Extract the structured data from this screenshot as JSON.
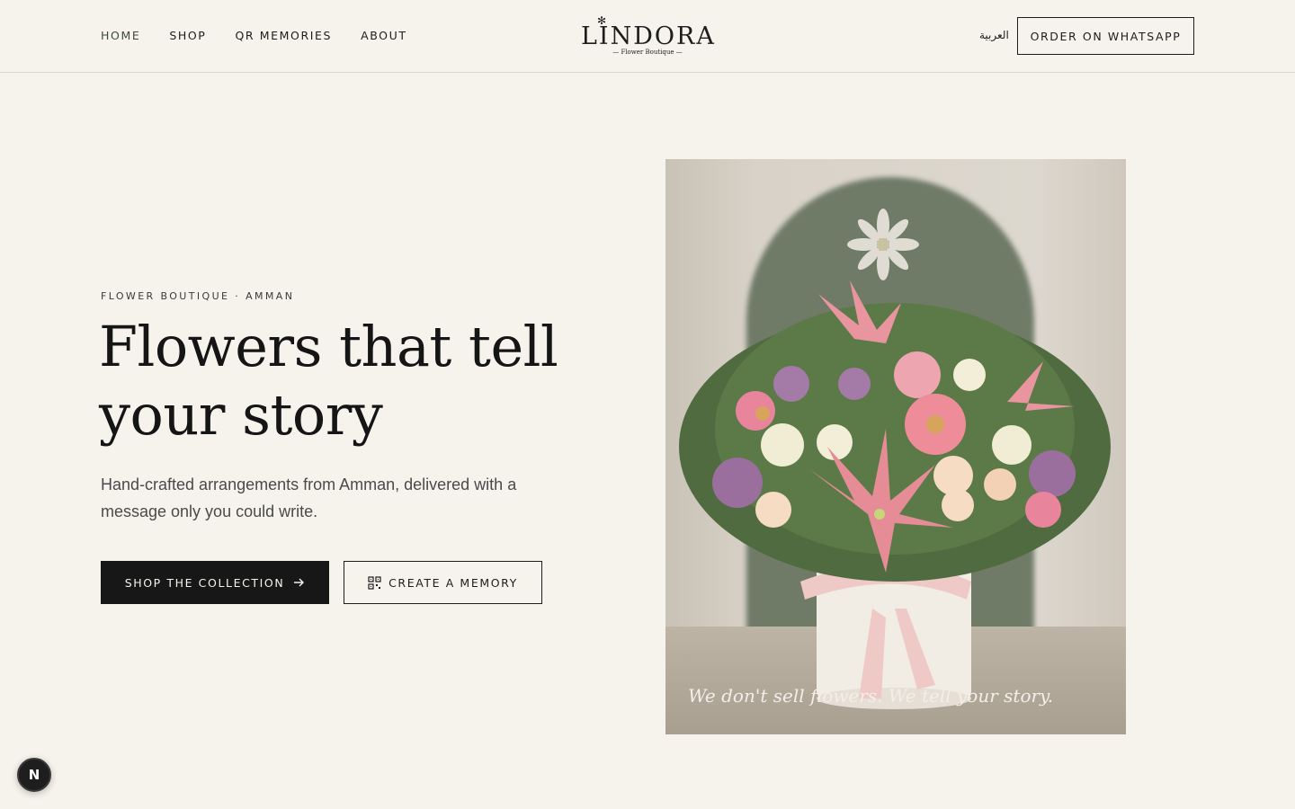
{
  "header": {
    "nav": [
      {
        "label": "HOME",
        "active": true
      },
      {
        "label": "SHOP"
      },
      {
        "label": "QR MEMORIES"
      },
      {
        "label": "ABOUT"
      }
    ],
    "logo": {
      "word": "LINDORA",
      "sub": "— Flower Boutique —"
    },
    "lang": "العربية",
    "cta": "ORDER ON WHATSAPP"
  },
  "hero": {
    "eyebrow": "FLOWER BOUTIQUE · AMMAN",
    "title_line1": "Flowers that tell",
    "title_line2": "your story",
    "lede": "Hand-crafted arrangements from Amman, delivered with a message only you could write.",
    "primary_cta": "SHOP THE COLLECTION",
    "secondary_cta": "CREATE A MEMORY",
    "photo_caption": "We don't sell flowers. We tell your story."
  },
  "fab": {
    "label": "N"
  },
  "colors": {
    "background": "#f6f3ec",
    "ink": "#171717",
    "arch": "#6f7a67"
  }
}
